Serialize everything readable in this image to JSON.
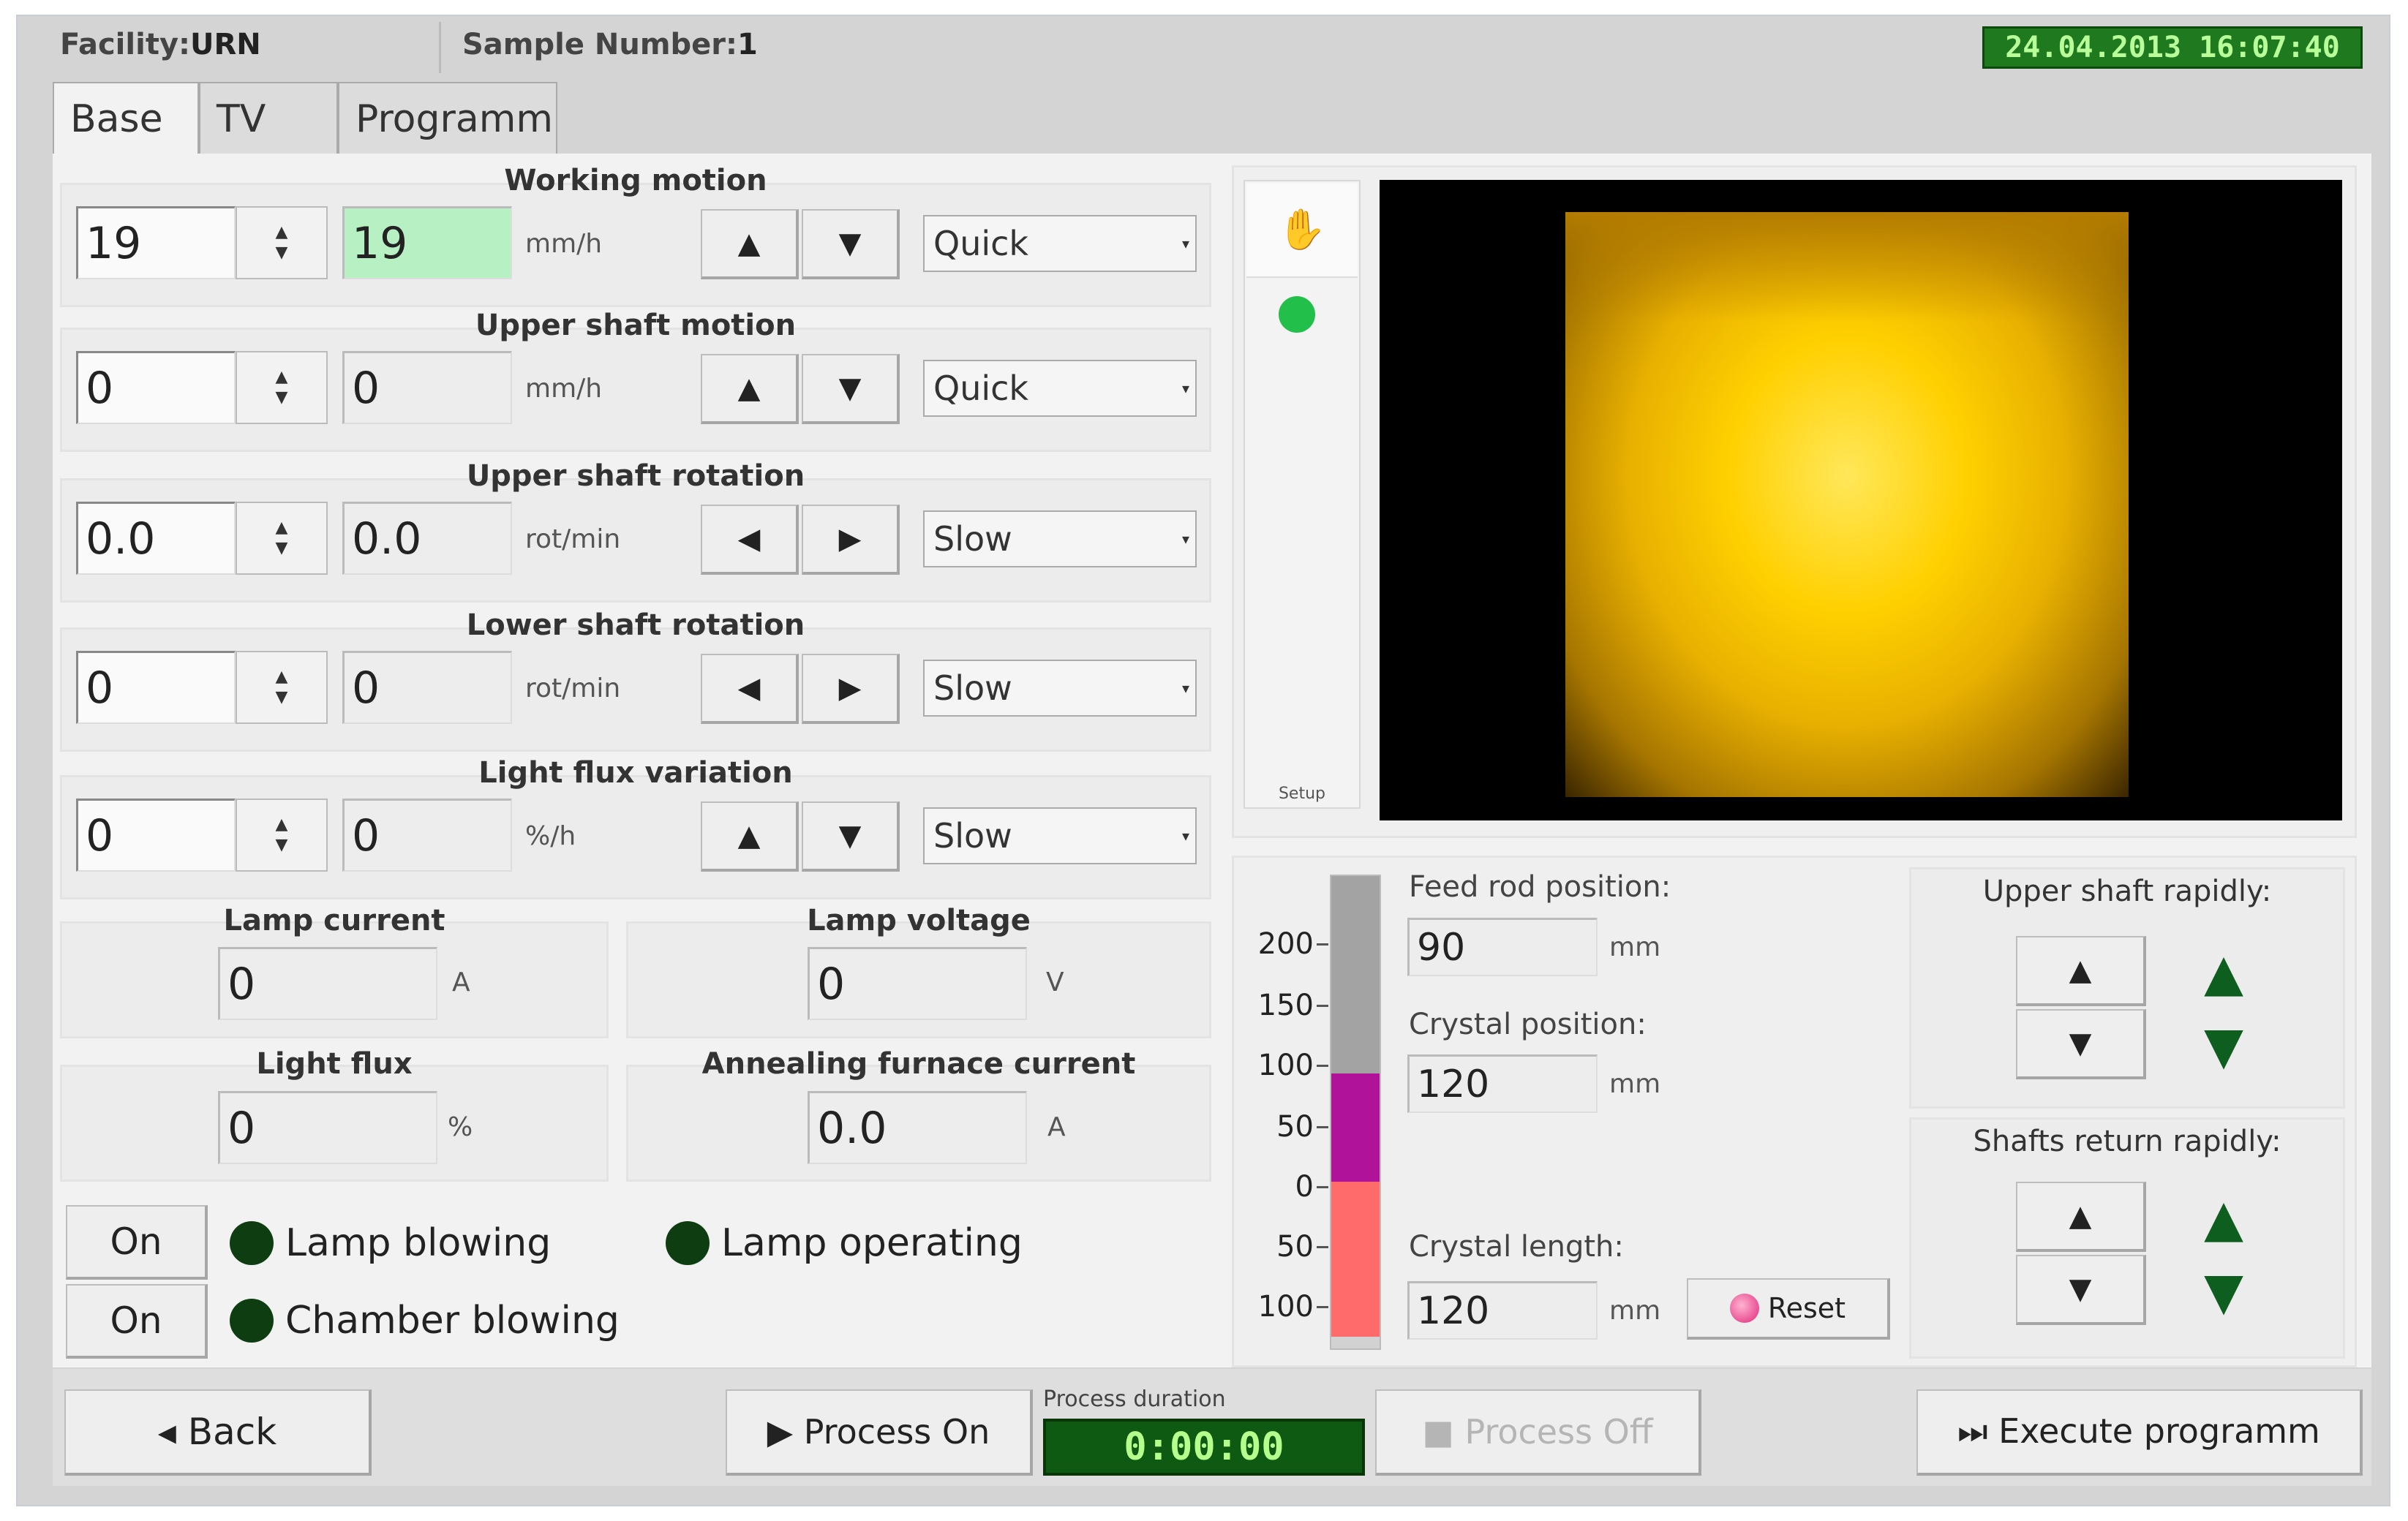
{
  "header": {
    "facility_label": "Facility:",
    "facility_value": "URN",
    "sample_label": "Sample Number:",
    "sample_value": "1",
    "datetime": "24.04.2013  16:07:40"
  },
  "tabs": [
    "Base",
    "TV",
    "Programm"
  ],
  "controls": [
    {
      "title": "Working motion",
      "setpoint": "19",
      "actual": "19",
      "unit": "mm/h",
      "btn1": "▲",
      "btn2": "▼",
      "mode": "Quick"
    },
    {
      "title": "Upper shaft motion",
      "setpoint": "0",
      "actual": "0",
      "unit": "mm/h",
      "btn1": "▲",
      "btn2": "▼",
      "mode": "Quick"
    },
    {
      "title": "Upper shaft rotation",
      "setpoint": "0.0",
      "actual": "0.0",
      "unit": "rot/min",
      "btn1": "◀",
      "btn2": "▶",
      "mode": "Slow"
    },
    {
      "title": "Lower shaft rotation",
      "setpoint": "0",
      "actual": "0",
      "unit": "rot/min",
      "btn1": "◀",
      "btn2": "▶",
      "mode": "Slow"
    },
    {
      "title": "Light flux variation",
      "setpoint": "0",
      "actual": "0",
      "unit": "%/h",
      "btn1": "▲",
      "btn2": "▼",
      "mode": "Slow"
    }
  ],
  "readouts": [
    {
      "title": "Lamp current",
      "value": "0",
      "unit": "A"
    },
    {
      "title": "Lamp voltage",
      "value": "0",
      "unit": "V"
    },
    {
      "title": "Light flux",
      "value": "0",
      "unit": "%"
    },
    {
      "title": "Annealing furnace current",
      "value": "0.0",
      "unit": "A"
    }
  ],
  "toggles": {
    "on1": "On",
    "on2": "On",
    "lamp_blowing": "Lamp blowing",
    "lamp_operating": "Lamp operating",
    "chamber_blowing": "Chamber blowing"
  },
  "video": {
    "setup_label": "Setup",
    "cursor_icon": "hand-icon",
    "status_color": "#22c04a"
  },
  "gauge": {
    "ticks": [
      "200",
      "150",
      "100",
      "50",
      "0",
      "50",
      "100"
    ],
    "feed_rod_label": "Feed rod position:",
    "feed_rod_value": "90",
    "crystal_position_label": "Crystal position:",
    "crystal_position_value": "120",
    "crystal_length_label": "Crystal length:",
    "crystal_length_value": "120",
    "unit": "mm",
    "reset_label": "Reset",
    "colors": {
      "upper": "#a3a3a3",
      "middle": "#b0139a",
      "lower": "#ff6b6b"
    }
  },
  "rapid": {
    "upper_title": "Upper shaft rapidly:",
    "return_title": "Shafts return rapidly:"
  },
  "footer": {
    "back": "◂ Back",
    "process_on": "▶ Process On",
    "duration_label": "Process duration",
    "duration_value": "0:00:00",
    "process_off": "■ Process Off",
    "execute": "⏭ Execute programm"
  }
}
